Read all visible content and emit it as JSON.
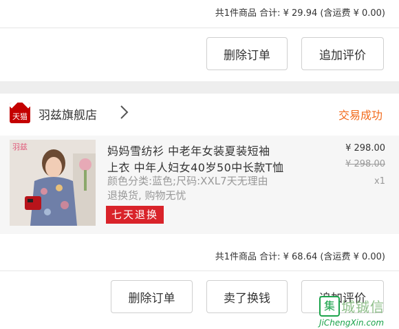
{
  "order1": {
    "summary": "共1件商品  合计: ¥ 29.94 (含运费 ¥ 0.00)",
    "buttons": {
      "delete": "删除订单",
      "review": "追加评价"
    }
  },
  "order2": {
    "store": {
      "logo_text": "天猫",
      "name": "羽兹旗舰店",
      "status": "交易成功"
    },
    "item": {
      "title_line1": "妈妈雪纺衫 中老年女装夏装短袖",
      "title_line2": "上衣 中年人妇女40岁50中长款T恤",
      "sku_line1": "颜色分类:蓝色;尺码:XXL7天无理由",
      "sku_line2": "退换货, 购物无忧",
      "badge": "七天退换",
      "price": "¥ 298.00",
      "original_price": "¥ 298.00",
      "quantity": "x1",
      "thumb_watermark": "羽兹"
    },
    "summary": "共1件商品  合计: ¥ 68.64 (含运费 ¥ 0.00)",
    "buttons": {
      "delete": "删除订单",
      "sell": "卖了换钱",
      "review": "追加评价"
    }
  },
  "watermark": {
    "icon_text": "集",
    "text": "城铖信",
    "url": "JiChengXin.com"
  },
  "colors": {
    "status": "#f26a1b",
    "badge": "#d9232a",
    "tmall": "#c40000",
    "watermark": "#1aa34a"
  }
}
